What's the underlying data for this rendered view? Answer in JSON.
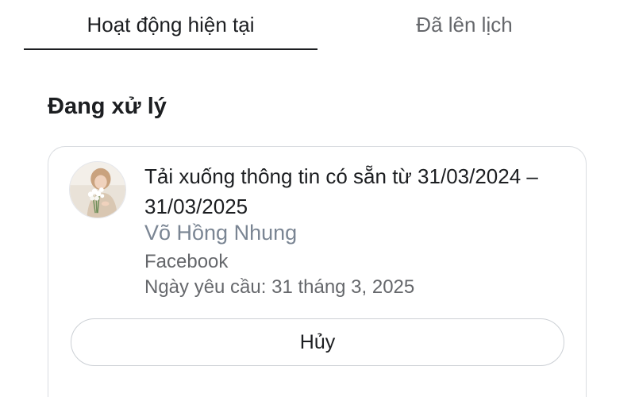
{
  "tabs": {
    "current": "Hoạt động hiện tại",
    "scheduled": "Đã lên lịch"
  },
  "section": {
    "title": "Đang xử lý"
  },
  "request": {
    "title": "Tải xuống thông tin có sẵn từ 31/03/2024 – 31/03/2025",
    "name": "Võ Hồng Nhung",
    "platform": "Facebook",
    "date": "Ngày yêu cầu: 31 tháng 3, 2025",
    "cancel_label": "Hủy"
  }
}
